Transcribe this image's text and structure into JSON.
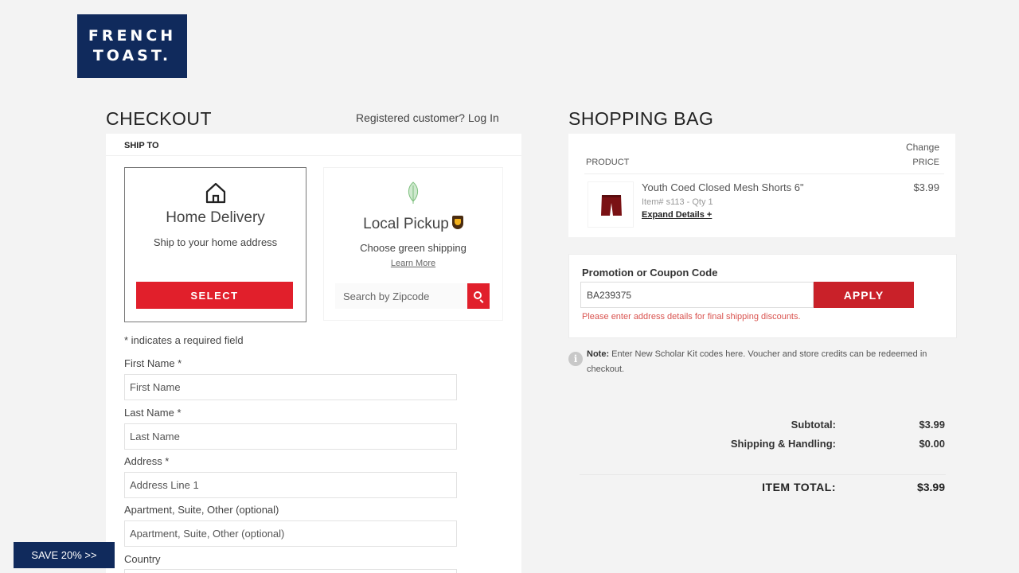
{
  "brand": {
    "line1": "FRENCH",
    "line2": "TOAST."
  },
  "checkout": {
    "title": "CHECKOUT",
    "registered_prompt": "Registered customer?",
    "login_link": "Log In",
    "ship_to": "SHIP TO",
    "home": {
      "title": "Home Delivery",
      "subtitle": "Ship to your home address",
      "button": "SELECT"
    },
    "pickup": {
      "title": "Local Pickup",
      "subtitle": "Choose green shipping",
      "learn_more": "Learn More",
      "zip_placeholder": "Search by Zipcode"
    },
    "required_note": "* indicates a required field",
    "fields": [
      {
        "label": "First Name *",
        "placeholder": "First Name"
      },
      {
        "label": "Last Name *",
        "placeholder": "Last Name"
      },
      {
        "label": "Address *",
        "placeholder": "Address Line 1"
      },
      {
        "label": "Apartment, Suite, Other (optional)",
        "placeholder": "Apartment, Suite, Other (optional)"
      },
      {
        "label": "Country",
        "placeholder": ""
      }
    ]
  },
  "save_banner": "SAVE 20% >>",
  "bag": {
    "title": "SHOPPING BAG",
    "change": "Change",
    "product_header": "PRODUCT",
    "price_header": "PRICE",
    "item": {
      "name": "Youth Coed Closed Mesh Shorts 6\"",
      "meta": "Item# s113 - Qty 1",
      "expand": "Expand Details +",
      "price": "$3.99"
    }
  },
  "promo": {
    "label": "Promotion or Coupon Code",
    "code": "BA239375",
    "apply": "APPLY",
    "error": "Please enter address details for final shipping discounts."
  },
  "note": {
    "bold": "Note:",
    "text": "Enter New Scholar Kit codes here. Voucher and store credits can be redeemed in checkout."
  },
  "totals": {
    "subtotal_label": "Subtotal:",
    "subtotal": "$3.99",
    "shipping_label": "Shipping & Handling:",
    "shipping": "$0.00",
    "item_total_label": "ITEM TOTAL:",
    "item_total": "$3.99"
  },
  "colors": {
    "brand_navy": "#102a5c",
    "accent_red": "#e11f2b",
    "apply_red": "#c92129"
  }
}
